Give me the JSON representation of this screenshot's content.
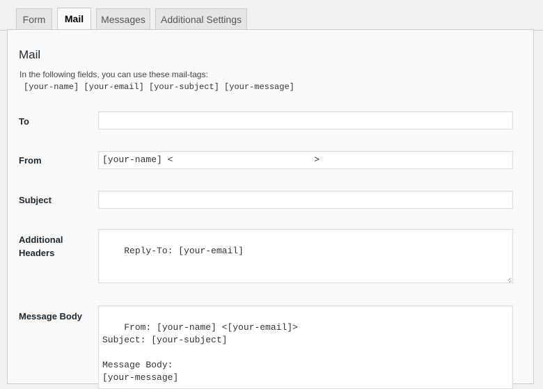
{
  "tabs": [
    {
      "label": "Form"
    },
    {
      "label": "Mail"
    },
    {
      "label": "Messages"
    },
    {
      "label": "Additional Settings"
    }
  ],
  "active_tab": "Mail",
  "panel": {
    "title": "Mail",
    "intro": "In the following fields, you can use these mail-tags:",
    "tags": "[your-name] [your-email] [your-subject] [your-message]"
  },
  "fields": {
    "to": {
      "label": "To",
      "value": ""
    },
    "from": {
      "label": "From",
      "value": "[your-name] <                          >"
    },
    "subject": {
      "label": "Subject",
      "value": ""
    },
    "headers": {
      "label_line1": "Additional",
      "label_line2": "Headers",
      "value": "Reply-To: [your-email]"
    },
    "body": {
      "label": "Message Body",
      "value": "From: [your-name] <[your-email]>\nSubject: [your-subject]\n\nMessage Body:\n[your-message]"
    }
  }
}
